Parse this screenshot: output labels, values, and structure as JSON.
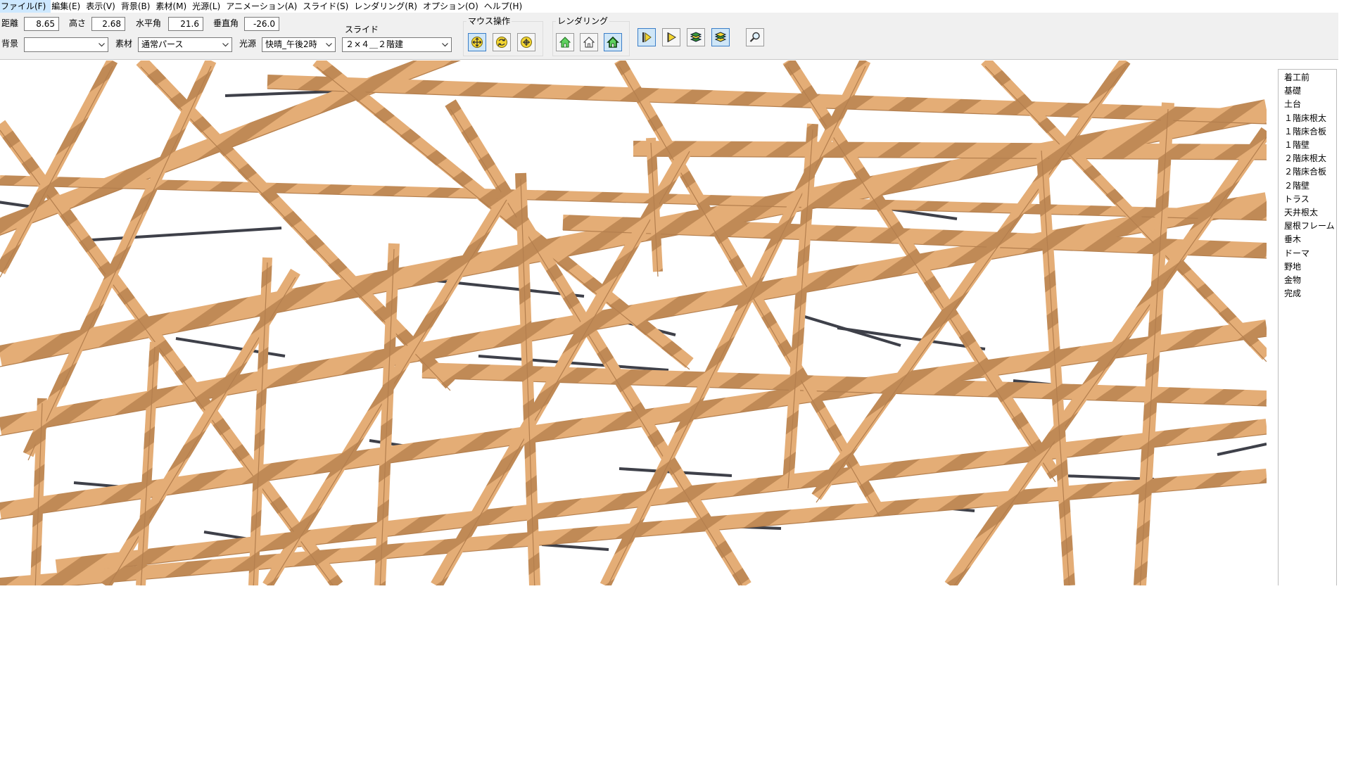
{
  "menu": [
    {
      "label": "ファイル(F)"
    },
    {
      "label": "編集(E)"
    },
    {
      "label": "表示(V)"
    },
    {
      "label": "背景(B)"
    },
    {
      "label": "素材(M)"
    },
    {
      "label": "光源(L)"
    },
    {
      "label": "アニメーション(A)"
    },
    {
      "label": "スライド(S)"
    },
    {
      "label": "レンダリング(R)"
    },
    {
      "label": "オプション(O)"
    },
    {
      "label": "ヘルプ(H)"
    }
  ],
  "camera": {
    "distance": {
      "label": "距離",
      "value": "8.65"
    },
    "height": {
      "label": "高さ",
      "value": "2.68"
    },
    "horizontal_angle": {
      "label": "水平角",
      "value": "21.6"
    },
    "vertical_angle": {
      "label": "垂直角",
      "value": "-26.0"
    }
  },
  "settings": {
    "background": {
      "label": "背景",
      "value": ""
    },
    "material": {
      "label": "素材",
      "value": "通常パース"
    },
    "light": {
      "label": "光源",
      "value": "快晴_午後2時"
    }
  },
  "slide_group": {
    "label": "スライド",
    "selected": "２×４＿２階建"
  },
  "mouse_group": {
    "label": "マウス操作",
    "buttons": [
      "move-icon",
      "rotate-icon",
      "zoom-icon"
    ]
  },
  "render_group": {
    "label": "レンダリング",
    "buttons": [
      "house-green-icon",
      "house-outline-icon",
      "house-framed-icon",
      "play-step-icon",
      "play-icon",
      "layers-icon",
      "layers-stack-icon",
      "magnifier-icon"
    ]
  },
  "slide_list": [
    "着工前",
    "基礎",
    "土台",
    "１階床根太",
    "１階床合板",
    "１階壁",
    "２階床根太",
    "２階床合板",
    "２階壁",
    "トラス",
    "天井根太",
    "屋根フレーム",
    "垂木",
    "ドーマ",
    "野地",
    "金物",
    "完成"
  ],
  "colors": {
    "wood": "#e4ad76",
    "wood_dark": "#b47f4e",
    "steel": "#3e4049",
    "sky": "#ffffff",
    "button_active": "#cfe6f7"
  }
}
